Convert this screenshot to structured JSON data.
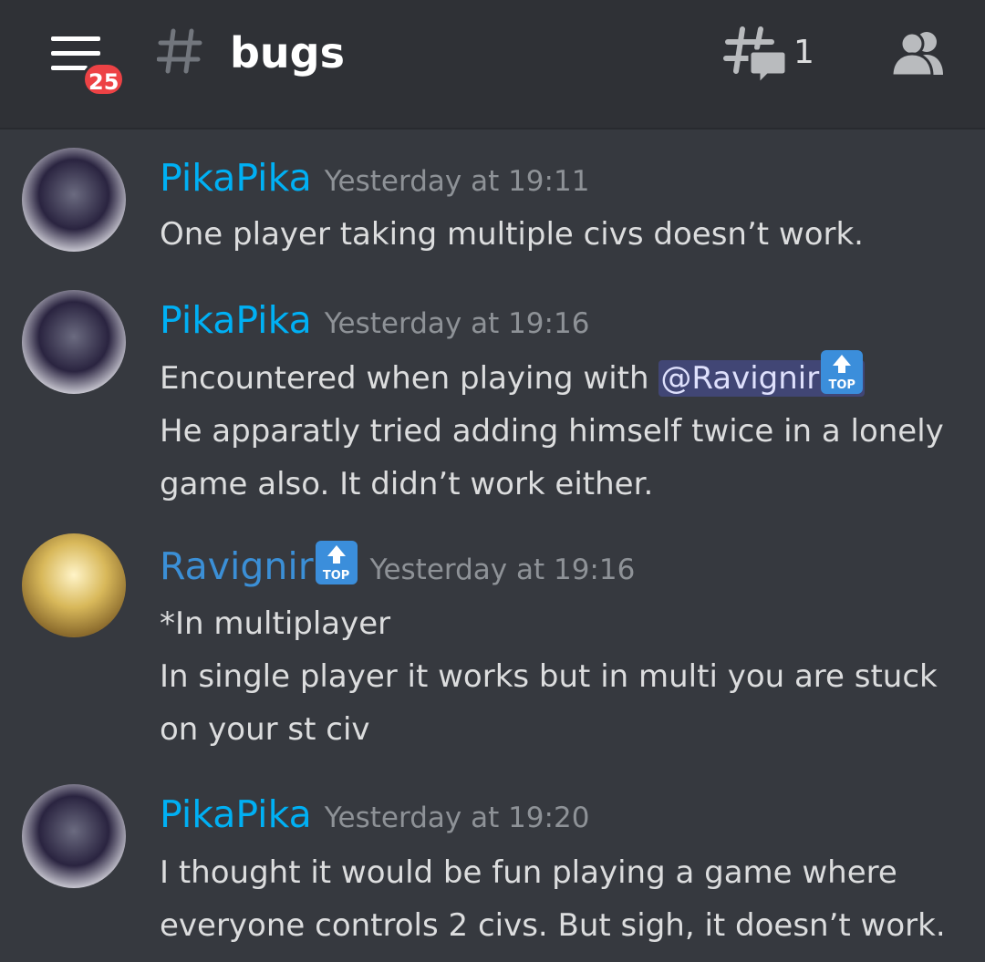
{
  "topbar": {
    "menu_badge": "25",
    "channel_name": "bugs",
    "threads_count": "1",
    "icons": [
      "hamburger-menu-icon",
      "channel-hash-icon",
      "threads-icon",
      "members-icon"
    ]
  },
  "colors": {
    "background": "#36393f",
    "topbar": "#2f3136",
    "username_cyan": "#00b0f4",
    "username_blue": "#3b8fd6",
    "badge_red": "#ed4245",
    "mention_bg": "#414675"
  },
  "messages": [
    {
      "author": "PikaPika",
      "timestamp": "Yesterday at 19:11",
      "lines": [
        "One player taking multiple civs doesn’t work."
      ]
    },
    {
      "author": "PikaPika",
      "timestamp": "Yesterday at 19:16",
      "mention_prefix": "Encountered when playing with ",
      "mention": "@Ravignir",
      "lines": [
        "He apparatly tried adding himself twice in a lonely",
        "game also. It didn’t work either."
      ]
    },
    {
      "author": "Ravignir",
      "author_emoji": "TOP",
      "timestamp": "Yesterday at 19:16",
      "lines": [
        "*In multiplayer",
        "In single player it works but in multi you are stuck",
        "on your st civ"
      ]
    },
    {
      "author": "PikaPika",
      "timestamp": "Yesterday at 19:20",
      "lines": [
        "I thought it would be fun playing a game where",
        "everyone controls 2 civs. But sigh, it doesn’t work."
      ]
    }
  ]
}
